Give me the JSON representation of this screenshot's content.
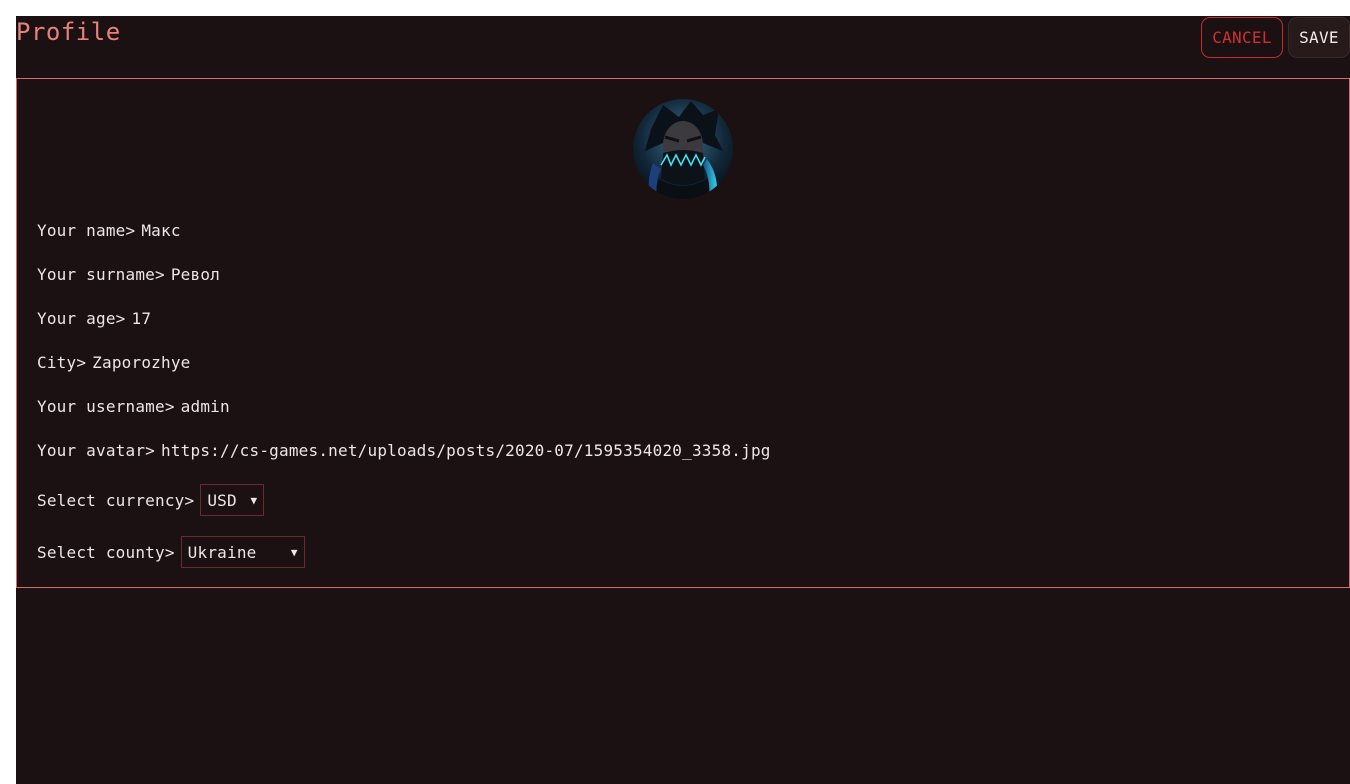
{
  "header": {
    "title": "Profile",
    "cancel_label": "CANCEL",
    "save_label": "SAVE"
  },
  "profile": {
    "avatar_icon": "avatar-icon",
    "fields": [
      {
        "label": "Your name>",
        "value": "Макс"
      },
      {
        "label": "Your surname>",
        "value": "Револ"
      },
      {
        "label": "Your age>",
        "value": "17"
      },
      {
        "label": "City>",
        "value": "Zaporozhye"
      },
      {
        "label": "Your username>",
        "value": "admin"
      },
      {
        "label": "Your avatar>",
        "value": "https://cs-games.net/uploads/posts/2020-07/1595354020_3358.jpg"
      }
    ],
    "currency": {
      "label": "Select currency>",
      "selected": "USD"
    },
    "country": {
      "label": "Select county>",
      "selected": "Ukraine"
    }
  },
  "colors": {
    "background": "#1b1112",
    "accent": "#e8807b",
    "cancel": "#c62a2a",
    "text": "#ece6e6"
  }
}
